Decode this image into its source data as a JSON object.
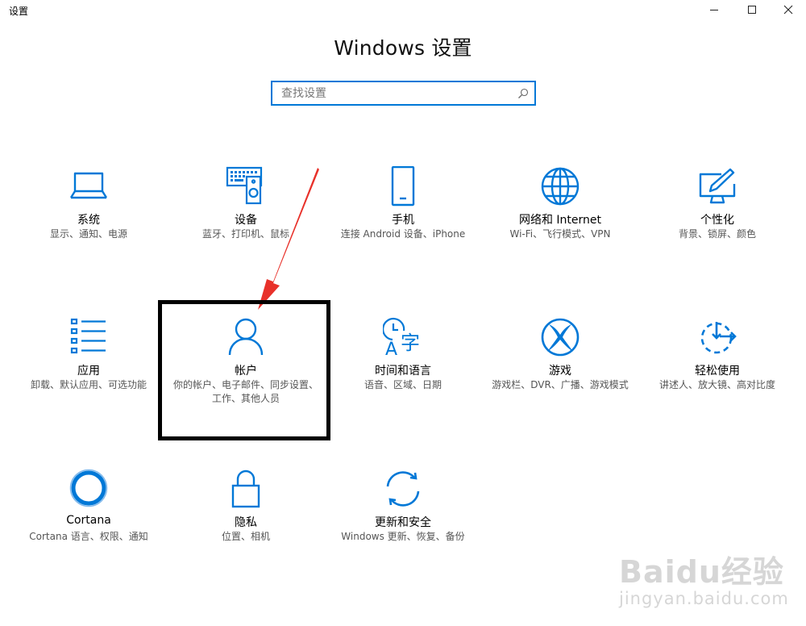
{
  "window": {
    "title": "设置",
    "controls": {
      "minimize": "minimize-icon",
      "maximize": "maximize-icon",
      "close": "close-icon"
    }
  },
  "heading": "Windows 设置",
  "search": {
    "placeholder": "查找设置",
    "value": "",
    "icon": "search-icon"
  },
  "tiles": [
    {
      "label": "系统",
      "desc": "显示、通知、电源",
      "icon": "laptop-icon"
    },
    {
      "label": "设备",
      "desc": "蓝牙、打印机、鼠标",
      "icon": "devices-icon"
    },
    {
      "label": "手机",
      "desc": "连接 Android 设备、iPhone",
      "icon": "phone-icon"
    },
    {
      "label": "网络和 Internet",
      "desc": "Wi-Fi、飞行模式、VPN",
      "icon": "globe-icon"
    },
    {
      "label": "个性化",
      "desc": "背景、锁屏、颜色",
      "icon": "personalization-icon"
    },
    {
      "label": "应用",
      "desc": "卸载、默认应用、可选功能",
      "icon": "apps-list-icon"
    },
    {
      "label": "帐户",
      "desc": "你的帐户、电子邮件、同步设置、工作、其他人员",
      "icon": "person-icon"
    },
    {
      "label": "时间和语言",
      "desc": "语音、区域、日期",
      "icon": "time-language-icon"
    },
    {
      "label": "游戏",
      "desc": "游戏栏、DVR、广播、游戏模式",
      "icon": "xbox-icon"
    },
    {
      "label": "轻松使用",
      "desc": "讲述人、放大镜、高对比度",
      "icon": "ease-of-access-icon"
    },
    {
      "label": "Cortana",
      "desc": "Cortana 语言、权限、通知",
      "icon": "cortana-icon"
    },
    {
      "label": "隐私",
      "desc": "位置、相机",
      "icon": "lock-icon"
    },
    {
      "label": "更新和安全",
      "desc": "Windows 更新、恢复、备份",
      "icon": "sync-icon"
    }
  ],
  "watermark": {
    "brand": "Baidu经验",
    "url": "jingyan.baidu.com"
  },
  "colors": {
    "accent": "#0078d7",
    "annotation_arrow": "#e8312a",
    "annotation_box": "#000000",
    "text": "#000000",
    "desc_text": "#555555"
  }
}
